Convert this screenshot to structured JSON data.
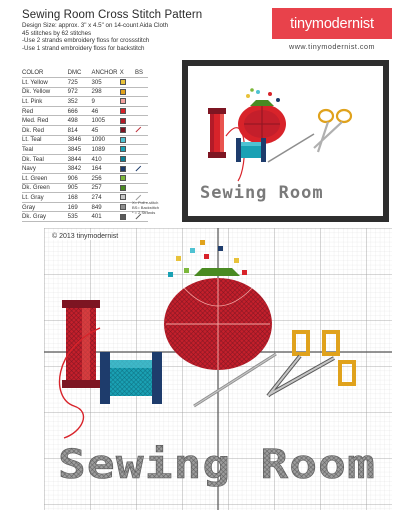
{
  "header": {
    "title": "Sewing Room Cross Stitch Pattern",
    "info": [
      "Design Size: approx. 3\" x 4.5\" on 14-count Aida Cloth",
      "45 stitches by 62 stitches",
      "-Use 2 strands embroidery floss for crossstitch",
      "-Use 1 strand embroidery floss for backstitch"
    ]
  },
  "brand": {
    "name": "tinymodernist",
    "website": "www.tinymodernist.com"
  },
  "legend": {
    "headers": {
      "color": "COLOR",
      "dmc": "DMC",
      "anchor": "ANCHOR",
      "x": "X",
      "bs": "BS"
    },
    "rows": [
      {
        "name": "Lt. Yellow",
        "dmc": "725",
        "anchor": "305",
        "swatch": "#e8c23a",
        "bs": ""
      },
      {
        "name": "Dk. Yellow",
        "dmc": "972",
        "anchor": "298",
        "swatch": "#e0a21c",
        "bs": ""
      },
      {
        "name": "Lt. Pink",
        "dmc": "352",
        "anchor": "9",
        "swatch": "#f4a3a0",
        "bs": ""
      },
      {
        "name": "Red",
        "dmc": "666",
        "anchor": "46",
        "swatch": "#d8232a",
        "bs": ""
      },
      {
        "name": "Med. Red",
        "dmc": "498",
        "anchor": "1005",
        "swatch": "#b31b28",
        "bs": ""
      },
      {
        "name": "Dk. Red",
        "dmc": "814",
        "anchor": "45",
        "swatch": "#7d1522",
        "bs": "#c0303a"
      },
      {
        "name": "Lt. Teal",
        "dmc": "3846",
        "anchor": "1090",
        "swatch": "#4fc2d2",
        "bs": ""
      },
      {
        "name": "Teal",
        "dmc": "3845",
        "anchor": "1089",
        "swatch": "#1aa1b4",
        "bs": ""
      },
      {
        "name": "Dk. Teal",
        "dmc": "3844",
        "anchor": "410",
        "swatch": "#0d7f94",
        "bs": ""
      },
      {
        "name": "Navy",
        "dmc": "3842",
        "anchor": "164",
        "swatch": "#1e3c6c",
        "bs": "#1e3c6c"
      },
      {
        "name": "Lt. Green",
        "dmc": "906",
        "anchor": "256",
        "swatch": "#7cb83a",
        "bs": ""
      },
      {
        "name": "Dk. Green",
        "dmc": "905",
        "anchor": "257",
        "swatch": "#4a8a22",
        "bs": ""
      },
      {
        "name": "Lt. Gray",
        "dmc": "168",
        "anchor": "274",
        "swatch": "#c6c6c6",
        "bs": "#9a9a9a"
      },
      {
        "name": "Gray",
        "dmc": "169",
        "anchor": "849",
        "swatch": "#8e8e8e",
        "bs": ""
      },
      {
        "name": "Dk. Gray",
        "dmc": "535",
        "anchor": "401",
        "swatch": "#5a5a5a",
        "bs": "#5a5a5a"
      }
    ],
    "notes": [
      "X= Full x-stitch",
      "BS= Backstitch",
      "* = 2 Strands"
    ]
  },
  "preview": {
    "caption": "Sewing Room"
  },
  "chart": {
    "copyright": "© 2013 tinymodernist",
    "caption": "Sewing Room"
  }
}
